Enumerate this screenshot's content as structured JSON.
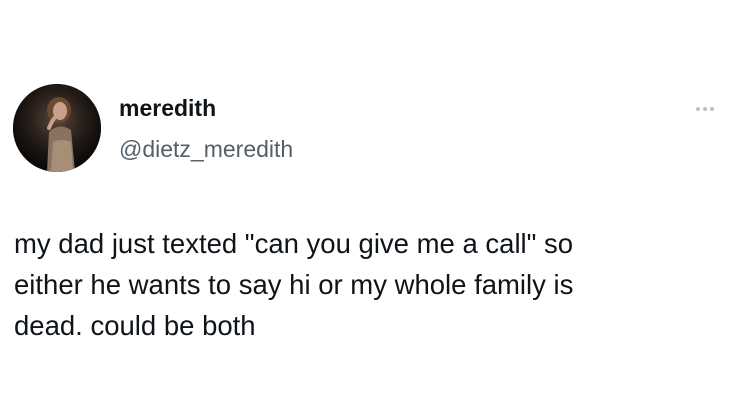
{
  "author": {
    "display_name": "meredith",
    "handle": "@dietz_meredith",
    "avatar_icon": "profile-photo"
  },
  "menu": {
    "icon": "more-options-icon"
  },
  "tweet": {
    "lines": [
      "my dad just texted \"can you give me a call\" so",
      "either he wants to say hi or my whole family is",
      "dead. could be both"
    ]
  }
}
